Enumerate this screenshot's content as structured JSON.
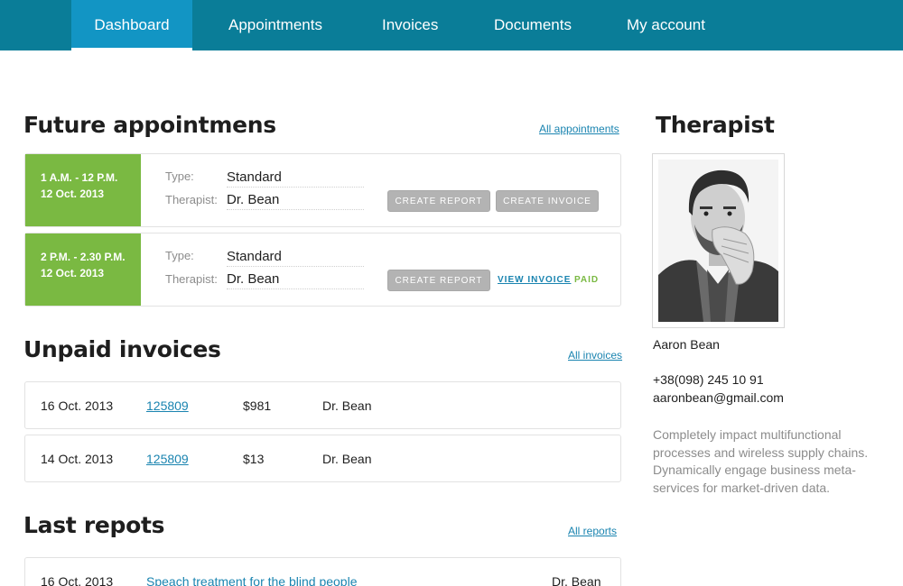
{
  "nav": {
    "items": [
      "Dashboard",
      "Appointments",
      "Invoices",
      "Documents",
      "My account"
    ],
    "active": 0
  },
  "appointments": {
    "title": "Future appointmens",
    "all_link": "All appointments",
    "type_label": "Type:",
    "therapist_label": "Therapist:",
    "create_report": "CREATE REPORT",
    "create_invoice": "CREATE INVOICE",
    "view_invoice": "VIEW INVOICE",
    "paid": "PAID",
    "items": [
      {
        "time": "1 A.M. - 12 P.M.",
        "date": "12 Oct. 2013",
        "type": "Standard",
        "therapist": "Dr. Bean"
      },
      {
        "time": "2 P.M. - 2.30 P.M.",
        "date": "12 Oct. 2013",
        "type": "Standard",
        "therapist": "Dr. Bean"
      }
    ]
  },
  "invoices": {
    "title": "Unpaid invoices",
    "all_link": "All invoices",
    "rows": [
      {
        "date": "16 Oct. 2013",
        "number": "125809",
        "amount": "$981",
        "therapist": "Dr. Bean"
      },
      {
        "date": "14 Oct. 2013",
        "number": "125809",
        "amount": "$13",
        "therapist": "Dr. Bean"
      }
    ]
  },
  "reports": {
    "title": "Last repots",
    "all_link": "All reports",
    "rows": [
      {
        "date": "16 Oct. 2013",
        "name": "Speach treatment for the blind people",
        "therapist": "Dr. Bean"
      }
    ]
  },
  "therapist": {
    "title": "Therapist",
    "name": "Aaron Bean",
    "phone": "+38(098) 245 10 91",
    "email": "aaronbean@gmail.com",
    "description": "Completely impact multifunctional processes and wireless supply chains. Dynamically engage business meta-services for market-driven data."
  },
  "colors": {
    "nav_bg": "#0a7d98",
    "nav_active": "#1295c4",
    "accent_green": "#7ab942",
    "link_blue": "#1a84b0",
    "button_gray": "#b3b3b3"
  }
}
